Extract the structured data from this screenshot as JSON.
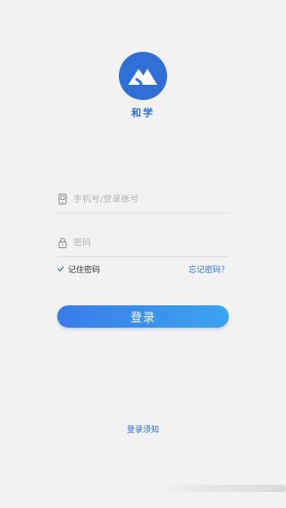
{
  "app": {
    "logo_text": "和学",
    "brand_color": "#2f6fd6"
  },
  "form": {
    "account_placeholder": "手机号/登录账号",
    "account_value": "",
    "account_icon": "phone-icon",
    "password_placeholder": "密码",
    "password_value": "",
    "password_icon": "lock-icon",
    "remember_label": "记住密码",
    "remember_checked": true,
    "forgot_label": "忘记密码？",
    "login_label": "登录"
  },
  "footer": {
    "notice_label": "登录须知"
  }
}
